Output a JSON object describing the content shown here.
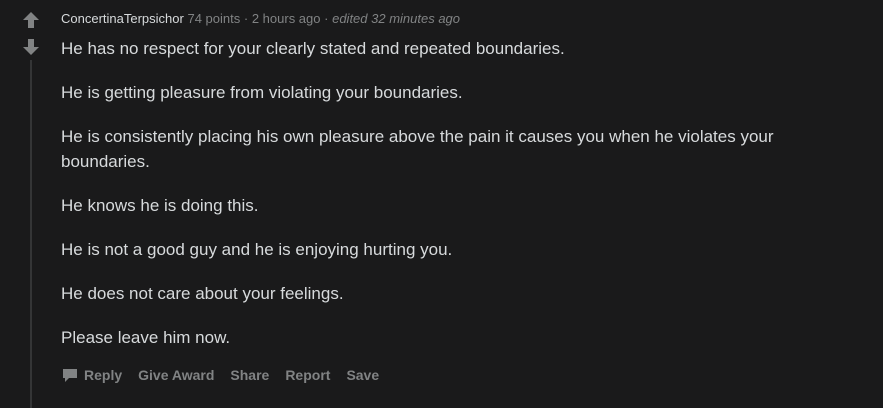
{
  "comment": {
    "author": "ConcertinaTerpsichor",
    "points": "74 points",
    "separator": "·",
    "time": "2 hours ago",
    "edited": "edited 32 minutes ago",
    "paragraphs": [
      "He has no respect for your clearly stated and repeated boundaries.",
      "He is getting pleasure from violating your boundaries.",
      "He is consistently placing his own pleasure above the pain it causes you when he violates your boundaries.",
      "He knows he is doing this.",
      "He is not a good guy and he is enjoying hurting you.",
      "He does not care about your feelings.",
      "Please leave him now."
    ],
    "actions": {
      "reply": "Reply",
      "give_award": "Give Award",
      "share": "Share",
      "report": "Report",
      "save": "Save"
    },
    "icons": {
      "upvote": "upvote-arrow-icon",
      "downvote": "downvote-arrow-icon",
      "reply": "speech-bubble-icon"
    }
  },
  "colors": {
    "background": "#1a1a1b",
    "text": "#d7dadc",
    "muted": "#818384",
    "thread_line": "#343536"
  }
}
